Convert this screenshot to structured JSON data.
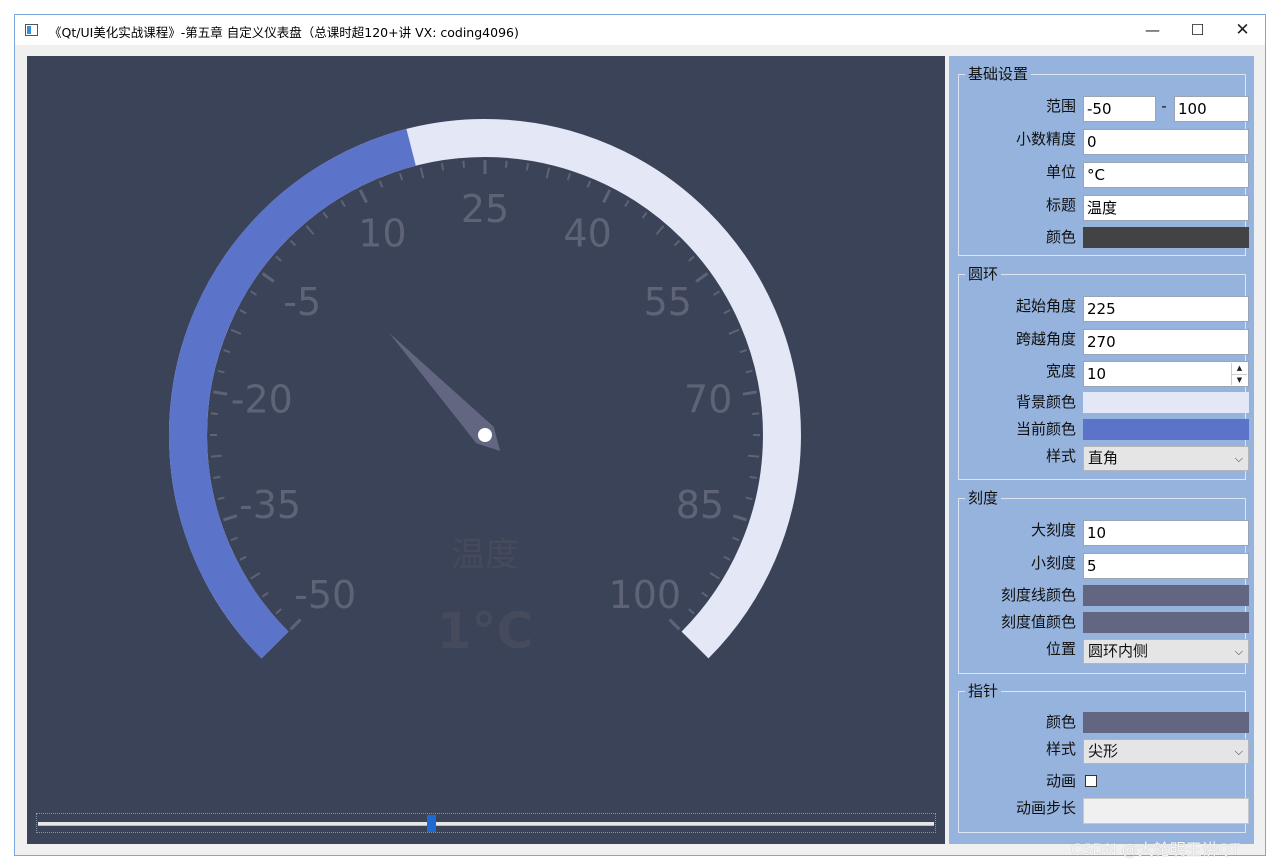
{
  "window": {
    "title": "《Qt/UI美化实战课程》-第五章 自定义仪表盘（总课时超120+讲 VX: coding4096)",
    "minimize_glyph": "—",
    "maximize_glyph": "☐",
    "close_glyph": "✕"
  },
  "gauge": {
    "range_min": -50,
    "range_max": 100,
    "start_angle": 225,
    "span_angle": 270,
    "current_value": 1,
    "tick_labels": [
      "-50",
      "-35",
      "-20",
      "-5",
      "10",
      "25",
      "40",
      "55",
      "70",
      "85",
      "100"
    ],
    "title": "温度",
    "value_text": "1°C",
    "colors": {
      "background": "#3b4358",
      "ring_background": "#e3e7f6",
      "ring_current": "#5b73c9",
      "ticks": "#5f6378",
      "pointer": "#626680",
      "title": "#454a5c"
    }
  },
  "slider": {
    "fraction": 0.44
  },
  "panel": {
    "basic": {
      "title": "基础设置",
      "range_label": "范围",
      "range_min": "-50",
      "range_sep": "-",
      "range_max": "100",
      "decimals_label": "小数精度",
      "decimals": "0",
      "unit_label": "单位",
      "unit": "°C",
      "caption_label": "标题",
      "caption": "温度",
      "color_label": "颜色",
      "color": "#434343"
    },
    "ring": {
      "title": "圆环",
      "start_label": "起始角度",
      "start": "225",
      "span_label": "跨越角度",
      "span": "270",
      "width_label": "宽度",
      "width": "10",
      "spin_up": "▲",
      "spin_down": "▼",
      "bg_label": "背景颜色",
      "bg_color": "#e3e7f6",
      "cur_label": "当前颜色",
      "cur_color": "#5b73c9",
      "style_label": "样式",
      "style": "直角"
    },
    "scale": {
      "title": "刻度",
      "major_label": "大刻度",
      "major": "10",
      "minor_label": "小刻度",
      "minor": "5",
      "line_color_label": "刻度线颜色",
      "line_color": "#626680",
      "value_color_label": "刻度值颜色",
      "value_color": "#626680",
      "position_label": "位置",
      "position": "圆环内侧"
    },
    "pointer": {
      "title": "指针",
      "color_label": "颜色",
      "color": "#626680",
      "style_label": "样式",
      "style": "尖形",
      "anim_label": "动画",
      "step_label": "动画步长",
      "step": ""
    }
  },
  "combo_arrow": "⌵",
  "watermark": "CSDN @大轮明王讲QT"
}
